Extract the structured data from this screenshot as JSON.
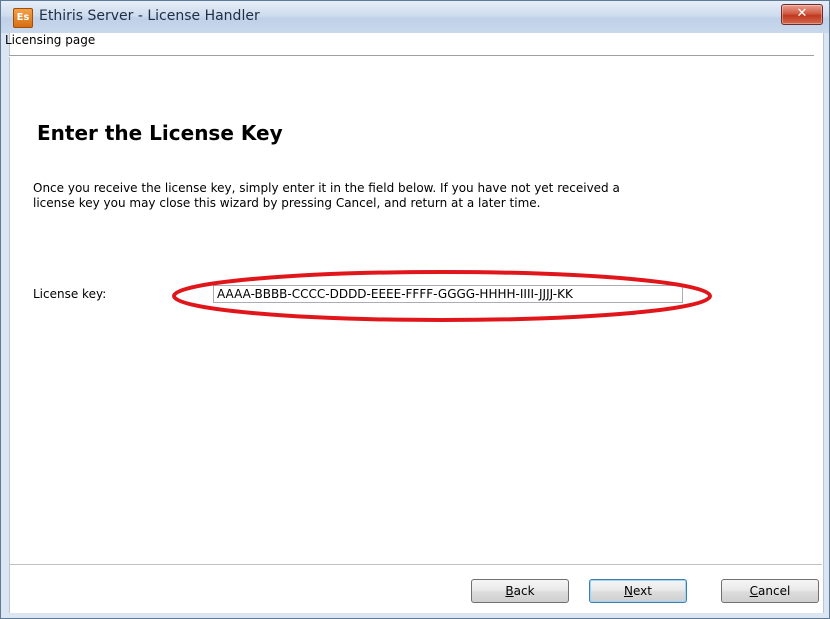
{
  "window": {
    "title": "Ethiris Server - License Handler",
    "icon_text": "Es",
    "close_glyph": "✕"
  },
  "breadcrumb": "Licensing page",
  "page": {
    "heading": "Enter the License Key",
    "description": "Once you receive the license key, simply enter it in the field below. If you have not yet received a license key you may close this wizard by pressing Cancel, and return at a later time."
  },
  "license": {
    "label": "License key:",
    "value": "AAAA-BBBB-CCCC-DDDD-EEEE-FFFF-GGGG-HHHH-IIII-JJJJ-KK"
  },
  "buttons": {
    "back": {
      "accel": "B",
      "rest": "ack"
    },
    "next": {
      "accel": "N",
      "rest": "ext"
    },
    "cancel": {
      "accel": "C",
      "rest": "ancel"
    }
  },
  "colors": {
    "highlight_ellipse": "#e0161b",
    "title_text": "#1e2f44",
    "close_button": "#c0391f"
  }
}
